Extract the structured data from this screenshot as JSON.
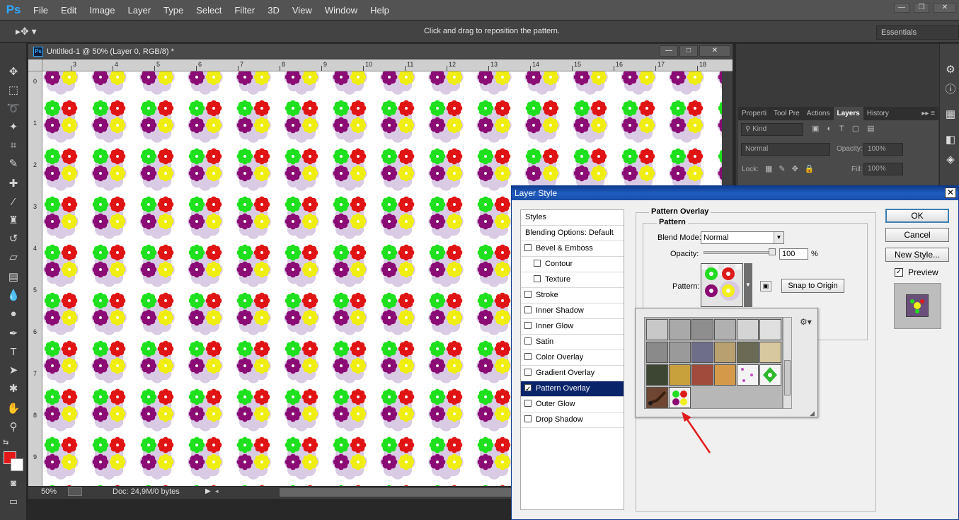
{
  "app": {
    "logo": "Ps"
  },
  "menu": [
    "File",
    "Edit",
    "Image",
    "Layer",
    "Type",
    "Select",
    "Filter",
    "3D",
    "View",
    "Window",
    "Help"
  ],
  "window_controls": {
    "minimize": "—",
    "restore": "❐",
    "close": "✕"
  },
  "options_bar": {
    "tool_icon": "move-tool-icon",
    "hint": "Click and drag to reposition the pattern.",
    "workspace": "Essentials"
  },
  "document": {
    "icon": "Ps",
    "title": "Untitled-1 @ 50% (Layer 0, RGB/8) *",
    "ruler_h": [
      "3",
      "4",
      "5",
      "6",
      "7",
      "8",
      "9",
      "10",
      "11",
      "12",
      "13",
      "14",
      "15",
      "16",
      "17",
      "18"
    ],
    "ruler_v": [
      "0",
      "1",
      "2",
      "3",
      "4",
      "5",
      "6",
      "7",
      "8",
      "9"
    ],
    "zoom": "50%",
    "doc_info": "Doc: 24,9M/0 bytes"
  },
  "panels": {
    "tabs": [
      "Properti",
      "Tool Pre",
      "Actions",
      "Layers",
      "History"
    ],
    "active_tab": "Layers",
    "kind_filter": "Kind",
    "blend_mode": "Normal",
    "opacity_label": "Opacity:",
    "opacity_value": "100%",
    "lock_label": "Lock:",
    "fill_label": "Fill:",
    "fill_value": "100%"
  },
  "layer_style": {
    "title": "Layer Style",
    "styles_header": "Styles",
    "blending_options": "Blending Options: Default",
    "effects": [
      {
        "label": "Bevel & Emboss",
        "checked": false,
        "indent": false
      },
      {
        "label": "Contour",
        "checked": false,
        "indent": true
      },
      {
        "label": "Texture",
        "checked": false,
        "indent": true
      },
      {
        "label": "Stroke",
        "checked": false,
        "indent": false
      },
      {
        "label": "Inner Shadow",
        "checked": false,
        "indent": false
      },
      {
        "label": "Inner Glow",
        "checked": false,
        "indent": false
      },
      {
        "label": "Satin",
        "checked": false,
        "indent": false
      },
      {
        "label": "Color Overlay",
        "checked": false,
        "indent": false
      },
      {
        "label": "Gradient Overlay",
        "checked": false,
        "indent": false
      },
      {
        "label": "Pattern Overlay",
        "checked": true,
        "indent": false,
        "selected": true
      },
      {
        "label": "Outer Glow",
        "checked": false,
        "indent": false
      },
      {
        "label": "Drop Shadow",
        "checked": false,
        "indent": false
      }
    ],
    "section_title": "Pattern Overlay",
    "group_title": "Pattern",
    "blend_mode_label": "Blend Mode:",
    "blend_mode_value": "Normal",
    "opacity_label": "Opacity:",
    "opacity_value": "100",
    "opacity_unit": "%",
    "opacity_level": 0.97,
    "pattern_label": "Pattern:",
    "snap_button": "Snap to Origin",
    "ok": "OK",
    "cancel": "Cancel",
    "new_style": "New Style...",
    "preview_label": "Preview",
    "preview_checked": true
  },
  "pattern_picker": {
    "swatches": [
      "#c8c8c8",
      "#a9a9a9",
      "#8e8e8e",
      "#b0b0b0",
      "#d4d4d4",
      "#e0e0e0",
      "#8a8a8a",
      "#9a9a9a",
      "#6e6e8a",
      "#b8a070",
      "#6b6b55",
      "#d8c8a0",
      "#3c4632",
      "#c8a03c",
      "#a04b3c",
      "#d49a4a",
      "#f4f4f4",
      "#58a858",
      "#6e4632",
      "#f0f0f0"
    ]
  },
  "colors": {
    "foreground": "#e41818",
    "background": "#ffffff",
    "dialog_title": "#1a4fa8",
    "selection": "#0a246a",
    "annotation_arrow": "#e01b1b"
  }
}
